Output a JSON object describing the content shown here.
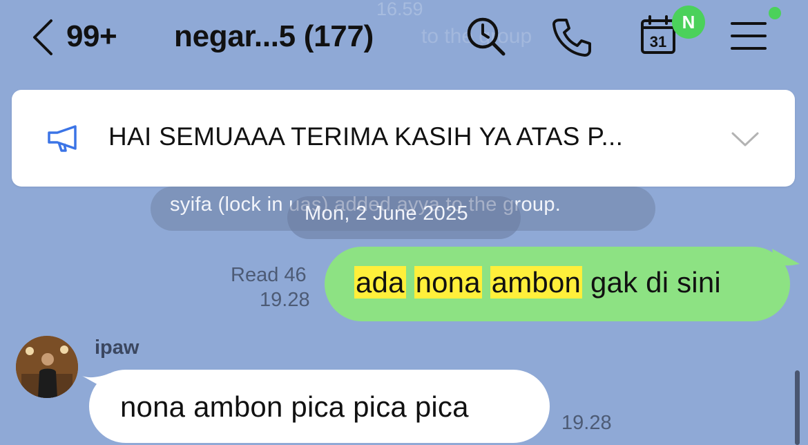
{
  "header": {
    "ghost_time": "16.59",
    "ghost_join": "to the group",
    "unread_count": "99+",
    "chat_title": "negar...5 (177)",
    "calendar_day": "31",
    "notes_badge": "N"
  },
  "announcement": {
    "text": "HAI SEMUAAA TERIMA KASIH YA ATAS P..."
  },
  "system": {
    "notice": "syifa (lock in uas) added ayya to the group.",
    "date": "Mon, 2 June 2025"
  },
  "sent_message": {
    "highlighted_words": [
      "ada",
      "nona",
      "ambon"
    ],
    "rest": " gak di sini",
    "read_status": "Read 46",
    "time": "19.28"
  },
  "received_message": {
    "sender": "ipaw",
    "text": "nona ambon pica pica pica",
    "time": "19.28"
  },
  "colors": {
    "background": "#8fa9d6",
    "sent_bubble": "#8de283",
    "highlight": "#ffef3b",
    "badge": "#4bd15b"
  },
  "icons": {
    "back": "chevron-left-icon",
    "search": "search-icon",
    "call": "phone-icon",
    "calendar": "calendar-icon",
    "menu": "menu-icon",
    "announcement": "megaphone-icon",
    "expand": "chevron-down-icon"
  }
}
